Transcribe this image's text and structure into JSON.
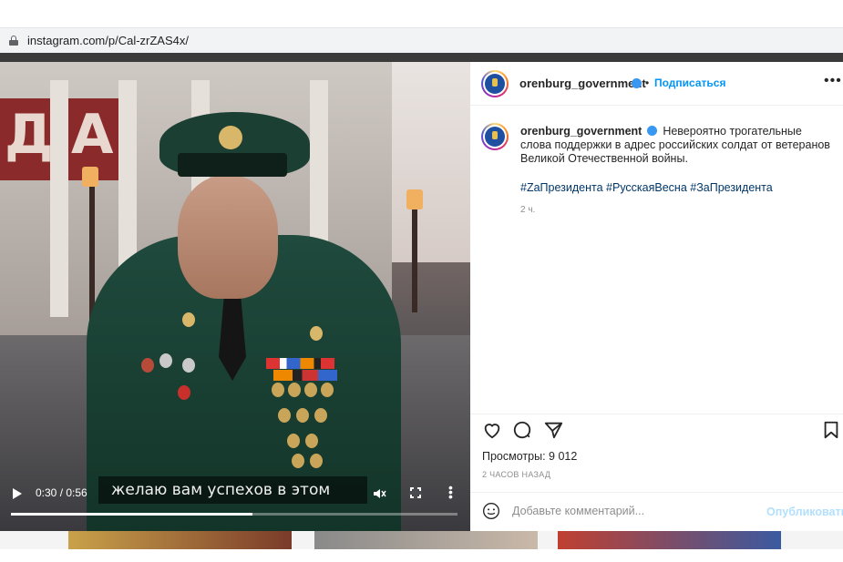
{
  "browser": {
    "url": "instagram.com/p/Cal-zrZAS4x/"
  },
  "video": {
    "subtitle": "желаю вам успехов в этом",
    "time": "0:30 / 0:56",
    "progress": 0.54
  },
  "post": {
    "username": "orenburg_government",
    "separator": "•",
    "follow_label": "Подписаться",
    "caption": "Невероятно трогательные слова поддержки в адрес российских солдат от ветеранов Великой Отечественной войны.",
    "hashtags": "#ZaПрезидента #РусскаяВесна #ЗаПрезидента",
    "time_ago": "2 ч.",
    "views_label": "Просмотры: 9 012",
    "posted_when": "2 ЧАСОВ НАЗАД",
    "comment_placeholder": "Добавьте комментарий...",
    "publish_label": "Опубликовать"
  },
  "icons": {
    "lock": "lock-icon",
    "play": "play-icon",
    "mute": "mute-icon",
    "fullscreen": "fullscreen-icon",
    "more": "more-vertical-icon",
    "like": "heart-icon",
    "comment": "comment-icon",
    "share": "send-icon",
    "save": "bookmark-icon",
    "emoji": "emoji-icon"
  },
  "colors": {
    "link": "#00376b",
    "follow": "#0095f6",
    "verified": "#3897f0",
    "publish_disabled": "#b2dffc"
  }
}
